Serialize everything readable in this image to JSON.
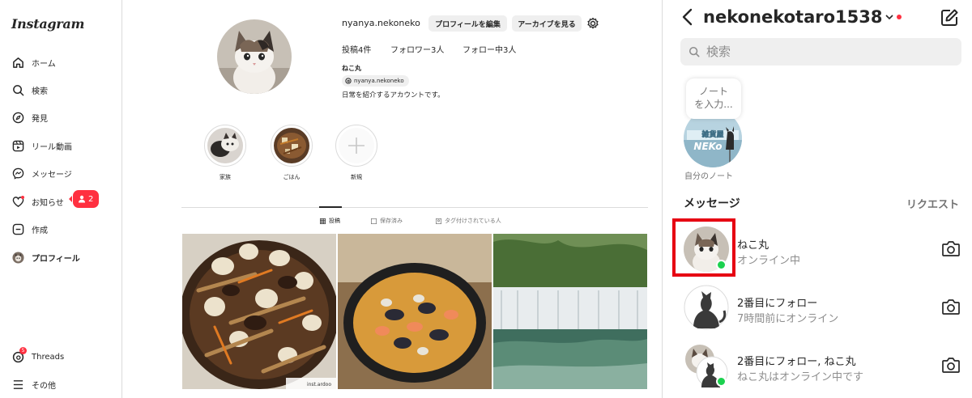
{
  "sidebar": {
    "logo": "Instagram",
    "items": [
      {
        "label": "ホーム"
      },
      {
        "label": "検索"
      },
      {
        "label": "発見"
      },
      {
        "label": "リール動画"
      },
      {
        "label": "メッセージ"
      },
      {
        "label": "お知らせ",
        "badge": "2"
      },
      {
        "label": "作成"
      },
      {
        "label": "プロフィール"
      }
    ],
    "threads": {
      "label": "Threads",
      "badge": "5"
    },
    "more": {
      "label": "その他"
    }
  },
  "profile": {
    "username": "nyanya.nekoneko",
    "edit_button": "プロフィールを編集",
    "archive_button": "アーカイブを見る",
    "posts": "投稿4件",
    "followers": "フォロワー3人",
    "following": "フォロー中3人",
    "display_name": "ねこ丸",
    "threads_tag": "nyanya.nekoneko",
    "bio": "日常を紹介するアカウントです。",
    "highlights": [
      {
        "label": "家族"
      },
      {
        "label": "ごはん"
      },
      {
        "label": "新規"
      }
    ],
    "tabs": [
      {
        "label": "投稿",
        "icon": "grid-icon"
      },
      {
        "label": "保存済み",
        "icon": "bookmark-icon"
      },
      {
        "label": "タグ付けされている人",
        "icon": "tag-icon"
      }
    ],
    "post_caption": "inst.ardoo"
  },
  "messages": {
    "account": "nekonekotaro1538",
    "search_placeholder": "検索",
    "note_text_line1": "ノート",
    "note_text_line2": "を入力...",
    "note_label": "自分のノート",
    "section_title": "メッセージ",
    "requests": "リクエスト",
    "conversations": [
      {
        "name": "ねこ丸",
        "status": "オンライン中",
        "online": true
      },
      {
        "name": "2番目にフォロー",
        "status": "7時間前にオンライン",
        "online": false
      },
      {
        "name": "2番目にフォロー, ねこ丸",
        "status": "ねこ丸はオンライン中です",
        "online": true
      }
    ]
  },
  "colors": {
    "accent_red": "#ff3040",
    "online_green": "#1cd14f",
    "highlight_box": "#e60012"
  }
}
